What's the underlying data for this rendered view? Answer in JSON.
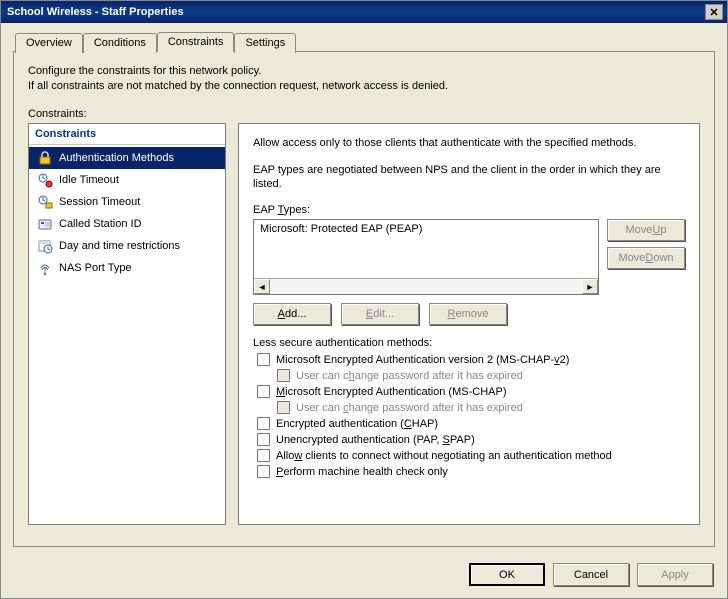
{
  "window": {
    "title": "School Wireless - Staff Properties",
    "close": "✕"
  },
  "tabs": [
    "Overview",
    "Conditions",
    "Constraints",
    "Settings"
  ],
  "active_tab_index": 2,
  "intro": {
    "line1": "Configure the constraints for this network policy.",
    "line2": "If all constraints are not matched by the connection request, network access is denied."
  },
  "constraints_label": "Constraints:",
  "tree": {
    "header": "Constraints",
    "items": [
      {
        "label": "Authentication Methods",
        "icon": "lock-icon"
      },
      {
        "label": "Idle Timeout",
        "icon": "idle-icon"
      },
      {
        "label": "Session Timeout",
        "icon": "session-icon"
      },
      {
        "label": "Called Station ID",
        "icon": "phone-icon"
      },
      {
        "label": "Day and time restrictions",
        "icon": "calendar-icon"
      },
      {
        "label": "NAS Port Type",
        "icon": "nas-icon"
      }
    ],
    "selected_index": 0
  },
  "right": {
    "desc1": "Allow access only to those clients that authenticate with the specified methods.",
    "desc2": "EAP types are negotiated between NPS and the client in the order in which they are listed.",
    "eap_types_label": "EAP Types:",
    "eap_items": [
      "Microsoft: Protected EAP (PEAP)"
    ],
    "move_up": "Move Up",
    "move_down": "Move Down",
    "add": "Add...",
    "edit": "Edit...",
    "remove": "Remove",
    "less_secure_label": "Less secure authentication methods:",
    "checks": [
      {
        "label": "Microsoft Encrypted Authentication version 2 (MS-CHAP-v2)",
        "checked": false,
        "disabled": false
      },
      {
        "label": "User can change password after it has expired",
        "checked": false,
        "disabled": true,
        "indent": true
      },
      {
        "label": "Microsoft Encrypted Authentication (MS-CHAP)",
        "checked": false,
        "disabled": false
      },
      {
        "label": "User can change password after it has expired",
        "checked": false,
        "disabled": true,
        "indent": true
      },
      {
        "label": "Encrypted authentication (CHAP)",
        "checked": false,
        "disabled": false
      },
      {
        "label": "Unencrypted authentication (PAP, SPAP)",
        "checked": false,
        "disabled": false
      },
      {
        "label": "Allow clients to connect without negotiating an authentication method",
        "checked": false,
        "disabled": false
      },
      {
        "label": "Perform machine health check only",
        "checked": false,
        "disabled": false
      }
    ]
  },
  "buttons": {
    "ok": "OK",
    "cancel": "Cancel",
    "apply": "Apply"
  },
  "underlines": {
    "eap_types": "T",
    "move_up": "U",
    "move_down": "D",
    "add": "A",
    "edit": "E",
    "remove": "R",
    "mschapv2": "v",
    "change1": "h",
    "mschap": "M",
    "change2": "c",
    "chap": "C",
    "pap": "S",
    "allow": "w",
    "perform": "P"
  }
}
